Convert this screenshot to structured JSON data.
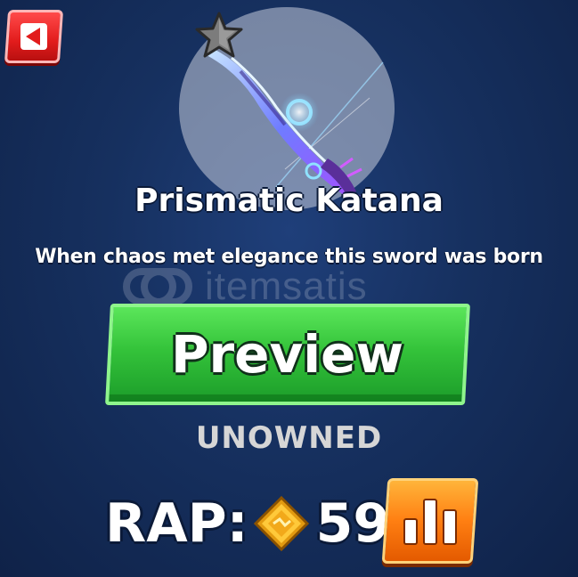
{
  "item": {
    "name": "Prismatic Katana",
    "description": "When chaos met elegance this sword was born",
    "status": "UNOWNED"
  },
  "buttons": {
    "back_icon": "back-arrow-icon",
    "preview_label": "Preview",
    "rap_stats_icon": "bar-chart-icon"
  },
  "rap": {
    "label": "RAP:",
    "value": "59",
    "currency_icon": "coin-icon"
  },
  "watermark": {
    "text": "itemsatis"
  },
  "colors": {
    "back_button": "#e21c1c",
    "preview_button": "#34c33a",
    "stats_button": "#ff7f12",
    "status_text": "#d6d6d6",
    "background": "#16305f"
  }
}
